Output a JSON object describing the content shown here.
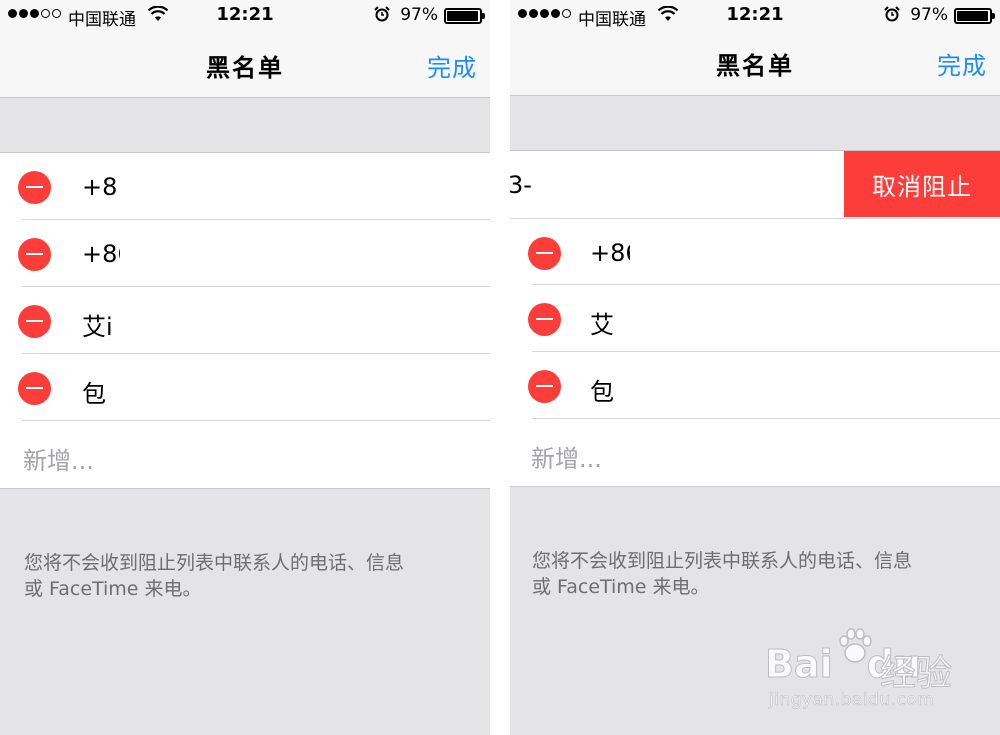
{
  "status": {
    "carrier": "中国联通",
    "time": "12:21",
    "battery": "97%",
    "battery_level": 0.97
  },
  "nav": {
    "title": "黑名单",
    "done": "完成"
  },
  "left": {
    "entries": [
      "+8(",
      "+86",
      "艾i",
      "包"
    ],
    "add_label": "新增...",
    "footer_line1": "您将不会收到阻止列表中联系人的电话、信息",
    "footer_line2": "或 FaceTime 来电。"
  },
  "right": {
    "swiped_entry": "3-",
    "unblock_label": "取消阻止",
    "entries": [
      "+86",
      "艾",
      "包"
    ],
    "add_label": "新增...",
    "footer_line1": "您将不会收到阻止列表中联系人的电话、信息",
    "footer_line2": "或 FaceTime 来电。"
  },
  "watermark": {
    "brand": "Bai",
    "brand_suffix": "du",
    "brand_cn": "经验",
    "url": "jingyan.baidu.com"
  },
  "colors": {
    "accent": "#1a8cff",
    "delete": "#fc3d39",
    "group_bg": "#e4e4e6"
  }
}
